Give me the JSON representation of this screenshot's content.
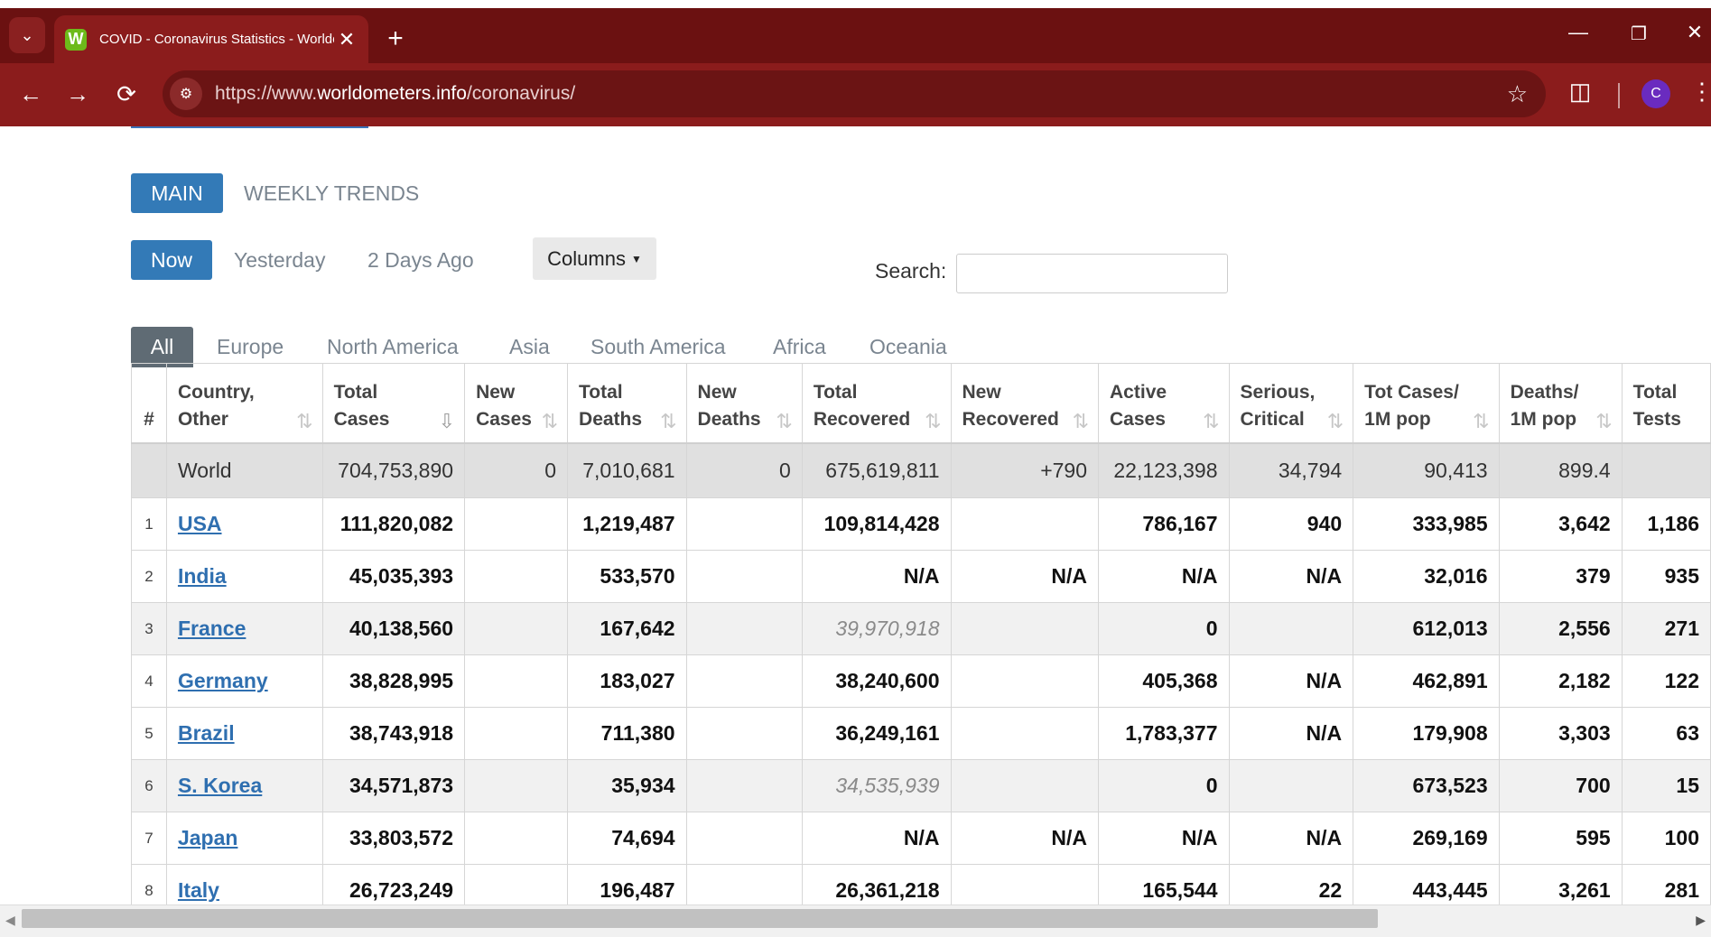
{
  "browser": {
    "tab_title": "COVID - Coronavirus Statistics - Worldometer",
    "favicon_letter": "W",
    "url_prefix": "https://www.",
    "url_domain": "worldometers.info",
    "url_path": "/coronavirus/",
    "profile_initial": "C"
  },
  "view_tabs": {
    "main": "MAIN",
    "weekly": "WEEKLY TRENDS"
  },
  "day_tabs": {
    "now": "Now",
    "yesterday": "Yesterday",
    "two_days": "2 Days Ago"
  },
  "columns_button": "Columns",
  "search": {
    "label": "Search:",
    "value": ""
  },
  "regions": [
    "All",
    "Europe",
    "North America",
    "Asia",
    "South America",
    "Africa",
    "Oceania"
  ],
  "table": {
    "headers": [
      {
        "l1": "#",
        "l2": ""
      },
      {
        "l1": "Country,",
        "l2": "Other"
      },
      {
        "l1": "Total",
        "l2": "Cases"
      },
      {
        "l1": "New",
        "l2": "Cases"
      },
      {
        "l1": "Total",
        "l2": "Deaths"
      },
      {
        "l1": "New",
        "l2": "Deaths"
      },
      {
        "l1": "Total",
        "l2": "Recovered"
      },
      {
        "l1": "New",
        "l2": "Recovered"
      },
      {
        "l1": "Active",
        "l2": "Cases"
      },
      {
        "l1": "Serious,",
        "l2": "Critical"
      },
      {
        "l1": "Tot Cases/",
        "l2": "1M pop"
      },
      {
        "l1": "Deaths/",
        "l2": "1M pop"
      },
      {
        "l1": "Total",
        "l2": "Tests"
      }
    ],
    "world": {
      "country": "World",
      "total_cases": "704,753,890",
      "new_cases": "0",
      "total_deaths": "7,010,681",
      "new_deaths": "0",
      "total_recovered": "675,619,811",
      "new_recovered": "+790",
      "active": "22,123,398",
      "critical": "34,794",
      "cases_per_m": "90,413",
      "deaths_per_m": "899.4",
      "tests": ""
    },
    "rows": [
      {
        "rank": "1",
        "country": "USA",
        "total_cases": "111,820,082",
        "new_cases": "",
        "total_deaths": "1,219,487",
        "new_deaths": "",
        "total_recovered": "109,814,428",
        "new_recovered": "",
        "active": "786,167",
        "critical": "940",
        "cases_per_m": "333,985",
        "deaths_per_m": "3,642",
        "tests": "1,186"
      },
      {
        "rank": "2",
        "country": "India",
        "total_cases": "45,035,393",
        "new_cases": "",
        "total_deaths": "533,570",
        "new_deaths": "",
        "total_recovered": "N/A",
        "new_recovered": "N/A",
        "active": "N/A",
        "critical": "N/A",
        "cases_per_m": "32,016",
        "deaths_per_m": "379",
        "tests": "935"
      },
      {
        "rank": "3",
        "country": "France",
        "total_cases": "40,138,560",
        "new_cases": "",
        "total_deaths": "167,642",
        "new_deaths": "",
        "total_recovered": "39,970,918",
        "new_recovered": "",
        "active": "0",
        "critical": "",
        "cases_per_m": "612,013",
        "deaths_per_m": "2,556",
        "tests": "271"
      },
      {
        "rank": "4",
        "country": "Germany",
        "total_cases": "38,828,995",
        "new_cases": "",
        "total_deaths": "183,027",
        "new_deaths": "",
        "total_recovered": "38,240,600",
        "new_recovered": "",
        "active": "405,368",
        "critical": "N/A",
        "cases_per_m": "462,891",
        "deaths_per_m": "2,182",
        "tests": "122"
      },
      {
        "rank": "5",
        "country": "Brazil",
        "total_cases": "38,743,918",
        "new_cases": "",
        "total_deaths": "711,380",
        "new_deaths": "",
        "total_recovered": "36,249,161",
        "new_recovered": "",
        "active": "1,783,377",
        "critical": "N/A",
        "cases_per_m": "179,908",
        "deaths_per_m": "3,303",
        "tests": "63"
      },
      {
        "rank": "6",
        "country": "S. Korea",
        "total_cases": "34,571,873",
        "new_cases": "",
        "total_deaths": "35,934",
        "new_deaths": "",
        "total_recovered": "34,535,939",
        "new_recovered": "",
        "active": "0",
        "critical": "",
        "cases_per_m": "673,523",
        "deaths_per_m": "700",
        "tests": "15"
      },
      {
        "rank": "7",
        "country": "Japan",
        "total_cases": "33,803,572",
        "new_cases": "",
        "total_deaths": "74,694",
        "new_deaths": "",
        "total_recovered": "N/A",
        "new_recovered": "N/A",
        "active": "N/A",
        "critical": "N/A",
        "cases_per_m": "269,169",
        "deaths_per_m": "595",
        "tests": "100"
      },
      {
        "rank": "8",
        "country": "Italy",
        "total_cases": "26,723,249",
        "new_cases": "",
        "total_deaths": "196,487",
        "new_deaths": "",
        "total_recovered": "26,361,218",
        "new_recovered": "",
        "active": "165,544",
        "critical": "22",
        "cases_per_m": "443,445",
        "deaths_per_m": "3,261",
        "tests": "281"
      }
    ]
  }
}
